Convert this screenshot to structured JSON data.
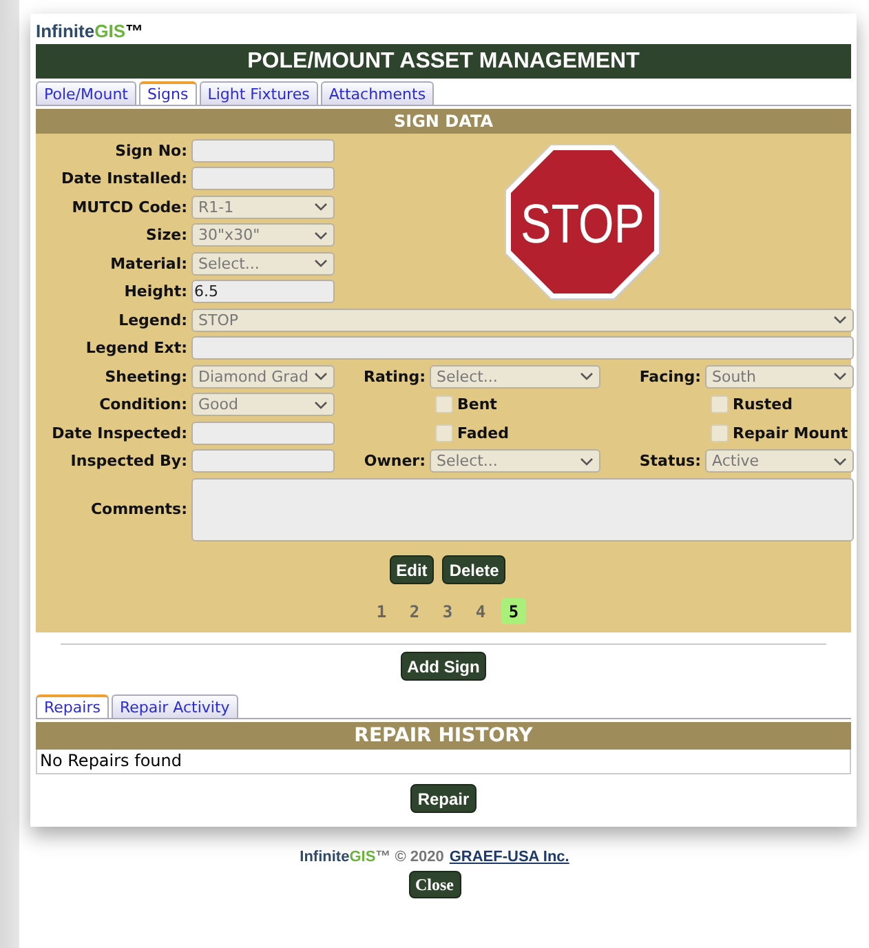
{
  "logo": {
    "name": "Infinite",
    "highlight": "GIS",
    "mark": "™"
  },
  "title": "POLE/MOUNT ASSET MANAGEMENT",
  "tabs": [
    {
      "label": "Pole/Mount",
      "selected": false
    },
    {
      "label": "Signs",
      "selected": true
    },
    {
      "label": "Light Fixtures",
      "selected": false
    },
    {
      "label": "Attachments",
      "selected": false
    }
  ],
  "sign_data": {
    "header": "SIGN DATA",
    "left_fields": [
      {
        "kind": "input",
        "label": "Sign No:"
      },
      {
        "kind": "input",
        "label": "Date Installed:"
      },
      {
        "kind": "select",
        "label": "MUTCD Code:",
        "value": "R1-1"
      },
      {
        "kind": "select",
        "label": "Size:",
        "value": "30\"x30\""
      },
      {
        "kind": "select",
        "label": "Material:",
        "value": "Select..."
      },
      {
        "kind": "input",
        "label": "Height:",
        "value": "6.5"
      }
    ],
    "sign_image": {
      "text": "STOP"
    },
    "full_fields": [
      {
        "kind": "select",
        "label": "Legend:",
        "value": "STOP"
      },
      {
        "kind": "input",
        "label": "Legend Ext:"
      }
    ],
    "grid_rows": [
      [
        {
          "kind": "select",
          "label": "Sheeting:",
          "value": "Diamond Grad"
        },
        {
          "kind": "select",
          "label": "Rating:",
          "value": "Select..."
        },
        {
          "kind": "select",
          "label": "Facing:",
          "value": "South"
        }
      ],
      [
        {
          "kind": "select",
          "label": "Condition:",
          "value": "Good"
        },
        {
          "kind": "checkbox",
          "label": "Bent",
          "checked": false
        },
        {
          "kind": "checkbox",
          "label": "Rusted",
          "checked": false
        }
      ],
      [
        {
          "kind": "input",
          "label": "Date Inspected:"
        },
        {
          "kind": "checkbox",
          "label": "Faded",
          "checked": false
        },
        {
          "kind": "checkbox",
          "label": "Repair Mount",
          "checked": false
        }
      ],
      [
        {
          "kind": "input",
          "label": "Inspected By:"
        },
        {
          "kind": "select",
          "label": "Owner:",
          "value": "Select..."
        },
        {
          "kind": "select",
          "label": "Status:",
          "value": "Active"
        }
      ]
    ],
    "comments": {
      "label": "Comments:"
    },
    "buttons": [
      "Edit",
      "Delete"
    ],
    "pages": [
      {
        "label": "1",
        "selected": false
      },
      {
        "label": "2",
        "selected": false
      },
      {
        "label": "3",
        "selected": false
      },
      {
        "label": "4",
        "selected": false
      },
      {
        "label": "5",
        "selected": true
      }
    ]
  },
  "add_button": "Add Sign",
  "repair_tabs": [
    {
      "label": "Repairs",
      "selected": true
    },
    {
      "label": "Repair Activity",
      "selected": false
    }
  ],
  "repair_history": {
    "header": "REPAIR HISTORY",
    "message": "No Repairs found",
    "button": "Repair"
  },
  "footer": {
    "name": "Infinite",
    "highlight": "GIS",
    "mark": "™",
    "copyright": "© 2020",
    "link": "GRAEF-USA Inc.",
    "close": "Close"
  }
}
